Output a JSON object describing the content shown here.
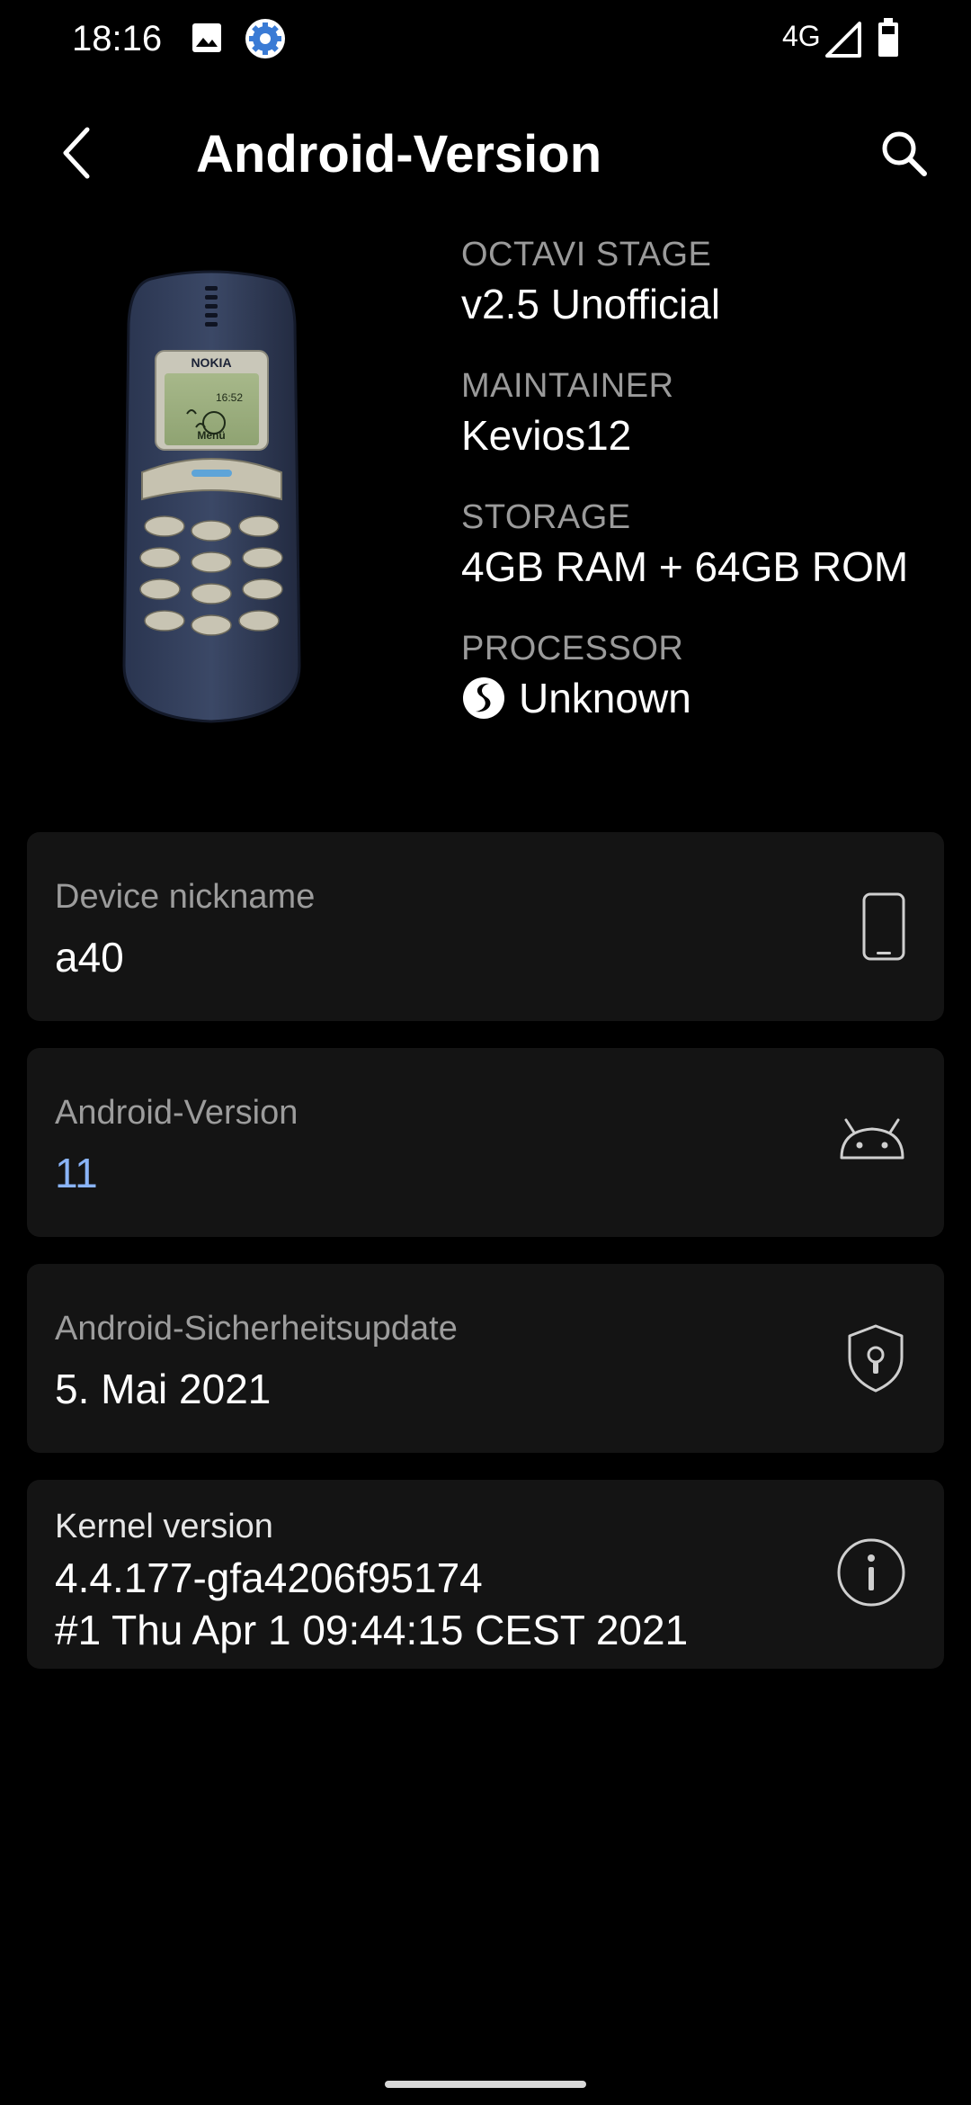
{
  "status_bar": {
    "time": "18:16",
    "network": "4G",
    "icons": [
      "image-icon",
      "settings-gear-icon",
      "signal-icon",
      "battery-icon"
    ]
  },
  "app_bar": {
    "title": "Android-Version",
    "icons": [
      "back-arrow-icon",
      "search-icon"
    ]
  },
  "device": {
    "image": "nokia-3310-phone",
    "brand_text": "NOKIA",
    "screen_time": "16:52",
    "screen_menu": "Menü"
  },
  "info": {
    "rom_label": "OCTAVI STAGE",
    "rom_value": "v2.5 Unofficial",
    "maintainer_label": "MAINTAINER",
    "maintainer_value": "Kevios12",
    "storage_label": "STORAGE",
    "storage_value": "4GB RAM + 64GB ROM",
    "processor_label": "PROCESSOR",
    "processor_value": "Unknown",
    "processor_icon": "snapdragon-logo-icon"
  },
  "cards": {
    "nickname": {
      "label": "Device nickname",
      "value": "a40",
      "icon": "phone-outline-icon"
    },
    "android_version": {
      "label": "Android-Version",
      "value": "11",
      "icon": "android-head-icon",
      "value_color": "#8ab4f8"
    },
    "security_update": {
      "label": "Android-Sicherheitsupdate",
      "value": "5. Mai 2021",
      "icon": "shield-lock-icon"
    },
    "kernel": {
      "label": "Kernel version",
      "line1": "4.4.177-gfa4206f95174",
      "line2": "#1 Thu Apr 1 09:44:15 CEST 2021",
      "icon": "info-circle-icon"
    }
  },
  "colors": {
    "background": "#000000",
    "card": "#141414",
    "label": "#9a9a9a",
    "accent": "#8ab4f8"
  }
}
